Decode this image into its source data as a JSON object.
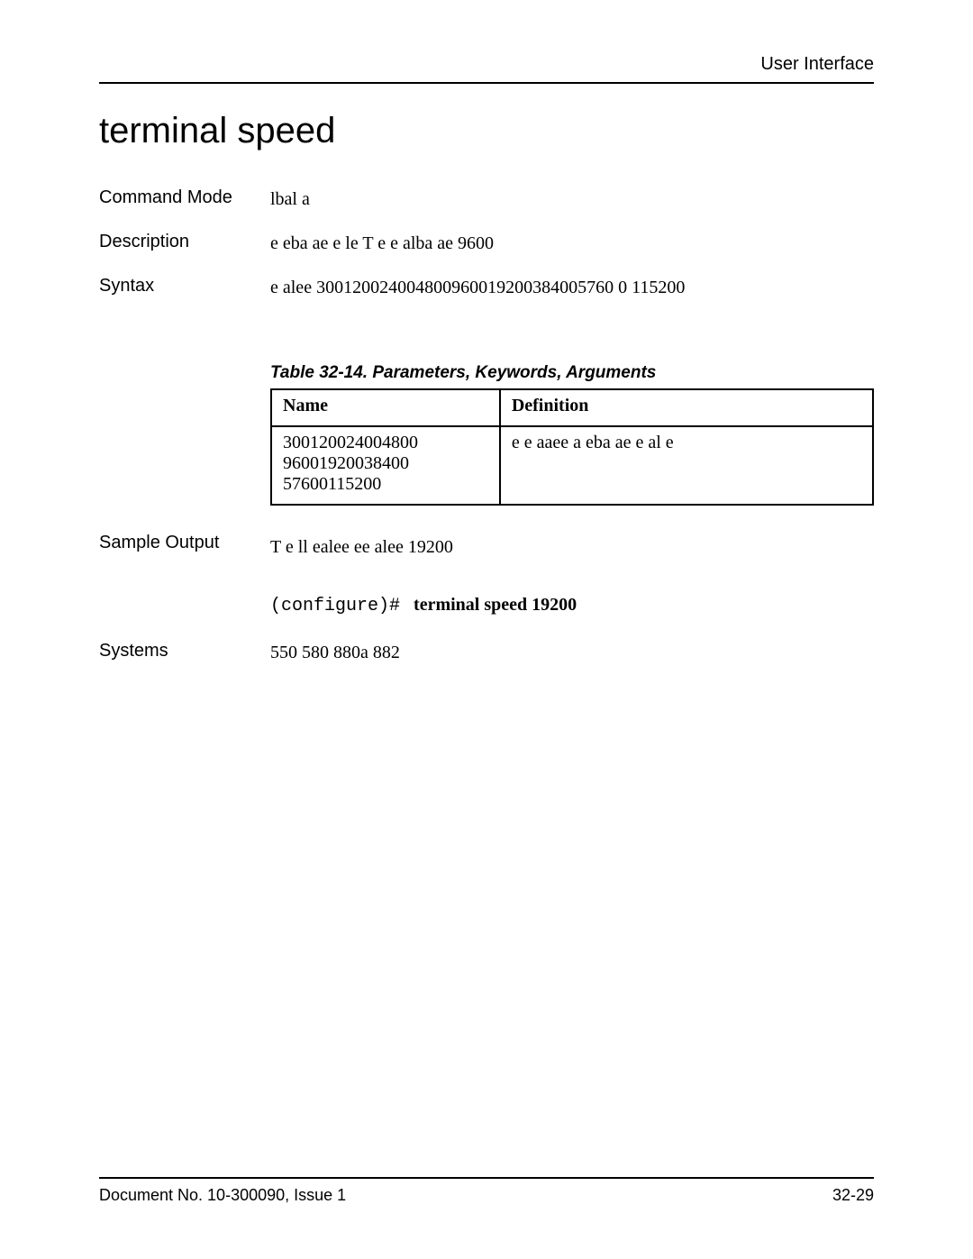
{
  "header": {
    "section": "User Interface"
  },
  "title": "terminal speed",
  "fields": {
    "command_mode_label": "Command Mode",
    "command_mode_value": "lbal      a",
    "description_label": "Description",
    "description_value": "e  eba  ae  e  le T  e  e alba  ae 9600",
    "syntax_label": "Syntax",
    "syntax_value": "e alee  300120024004800960019200384005760 0 115200",
    "sample_output_label": "Sample Output",
    "sample_output_value": "T  e ll   ealee  ee alee  19200",
    "sample_output_prompt": "(configure)#",
    "sample_output_command": "terminal speed 19200",
    "systems_label": "Systems",
    "systems_value": "550    580  880a    882"
  },
  "table": {
    "caption": "Table 32-14.  Parameters, Keywords, Arguments",
    "header": {
      "name": "Name",
      "definition": "Definition"
    },
    "row": {
      "name": "300120024004800 96001920038400 57600115200",
      "definition": "e e  aaee     a      eba  ae       e     al e"
    }
  },
  "footer": {
    "doc": "Document No. 10-300090, Issue 1",
    "page": "32-29"
  }
}
